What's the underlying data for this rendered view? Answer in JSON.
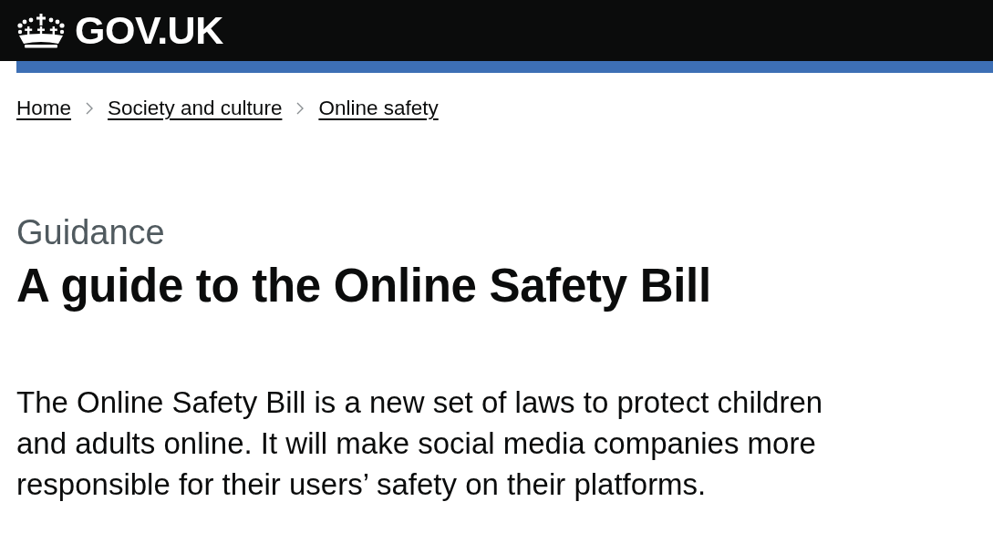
{
  "header": {
    "logo_text": "GOV.UK"
  },
  "breadcrumbs": [
    {
      "label": "Home"
    },
    {
      "label": "Society and culture"
    },
    {
      "label": "Online safety"
    }
  ],
  "caption": "Guidance",
  "title": "A guide to the Online Safety Bill",
  "lead": "The Online Safety Bill is a new set of laws to protect children and adults online. It will make social media companies more responsible for their users’ safety on their platforms."
}
